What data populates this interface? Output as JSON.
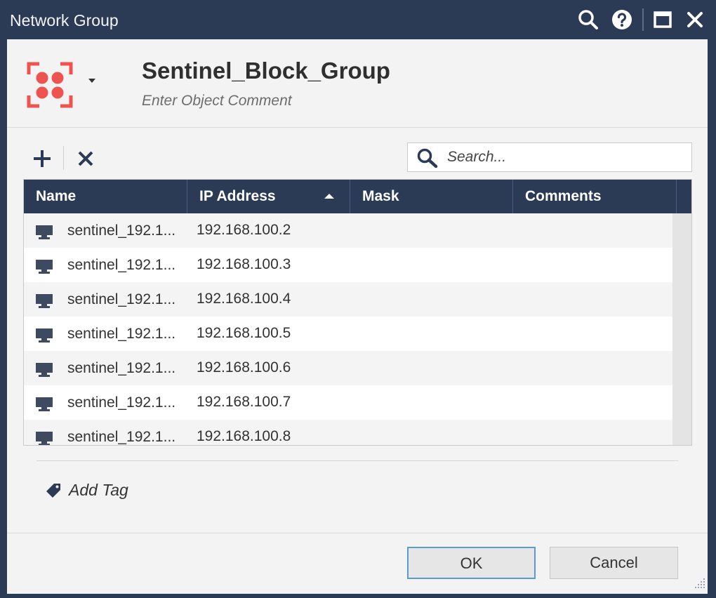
{
  "window": {
    "title": "Network Group",
    "icons": [
      "search-icon",
      "help-icon",
      "maximize-icon",
      "close-icon"
    ]
  },
  "header": {
    "object_name": "Sentinel_Block_Group",
    "comment_placeholder": "Enter Object Comment",
    "object_icon": "network-group-icon"
  },
  "toolbar": {
    "add_icon": "plus-icon",
    "remove_icon": "x-icon",
    "search_placeholder": "Search..."
  },
  "table": {
    "columns": [
      "Name",
      "IP Address",
      "Mask",
      "Comments"
    ],
    "sorted_column": "IP Address",
    "sort_direction": "ascending",
    "rows": [
      {
        "name": "sentinel_192.1...",
        "ip": "192.168.100.2",
        "mask": "",
        "comments": ""
      },
      {
        "name": "sentinel_192.1...",
        "ip": "192.168.100.3",
        "mask": "",
        "comments": ""
      },
      {
        "name": "sentinel_192.1...",
        "ip": "192.168.100.4",
        "mask": "",
        "comments": ""
      },
      {
        "name": "sentinel_192.1...",
        "ip": "192.168.100.5",
        "mask": "",
        "comments": ""
      },
      {
        "name": "sentinel_192.1...",
        "ip": "192.168.100.6",
        "mask": "",
        "comments": ""
      },
      {
        "name": "sentinel_192.1...",
        "ip": "192.168.100.7",
        "mask": "",
        "comments": ""
      },
      {
        "name": "sentinel_192.1...",
        "ip": "192.168.100.8",
        "mask": "",
        "comments": ""
      }
    ]
  },
  "tags": {
    "add_tag_label": "Add Tag"
  },
  "buttons": {
    "ok": "OK",
    "cancel": "Cancel"
  },
  "colors": {
    "titlebar": "#2b3a55",
    "group_icon": "#ef5350",
    "focus_border": "#5b9bd5"
  }
}
